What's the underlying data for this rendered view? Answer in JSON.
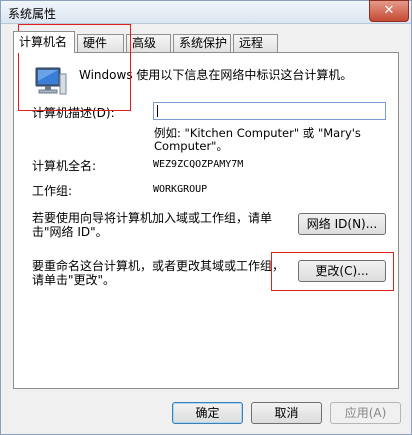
{
  "window": {
    "title": "系统属性",
    "close": "✕"
  },
  "tabs": [
    {
      "label": "计算机名",
      "active": true
    },
    {
      "label": "硬件"
    },
    {
      "label": "高级"
    },
    {
      "label": "系统保护"
    },
    {
      "label": "远程"
    }
  ],
  "intro": "Windows 使用以下信息在网络中标识这台计算机。",
  "description": {
    "label": "计算机描述(D):",
    "value": "",
    "example_line1": "例如: \"Kitchen Computer\" 或 \"Mary's",
    "example_line2": "Computer\"。"
  },
  "full_name": {
    "label": "计算机全名:",
    "value": "WEZ9ZCQOZPAMY7M"
  },
  "workgroup": {
    "label": "工作组:",
    "value": "WORKGROUP"
  },
  "network_id": {
    "text_line1": "若要使用向导将计算机加入域或工作组，请单",
    "text_line2": "击\"网络 ID\"。",
    "button": "网络 ID(N)..."
  },
  "rename": {
    "text_line1": "要重命名这台计算机，或者更改其域或工作组，",
    "text_line2": "请单击\"更改\"。",
    "button": "更改(C)..."
  },
  "footer": {
    "ok": "确定",
    "cancel": "取消",
    "apply": "应用(A)"
  },
  "colors": {
    "highlight": "#e0201c",
    "accent": "#3c7fb1"
  }
}
